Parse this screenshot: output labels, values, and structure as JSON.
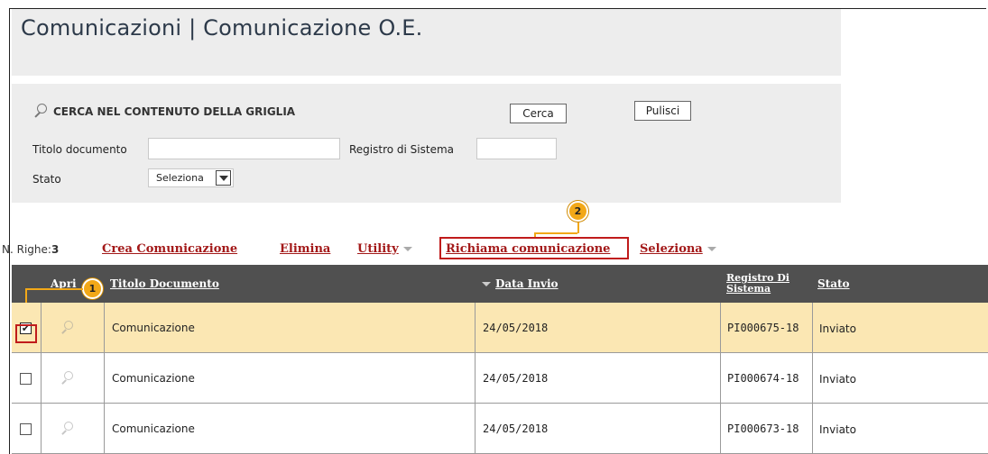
{
  "page": {
    "title": "Comunicazioni | Comunicazione O.E."
  },
  "search": {
    "heading": "CERCA NEL CONTENUTO DELLA GRIGLIA",
    "search_button": "Cerca",
    "clear_button": "Pulisci",
    "fields": {
      "titolo_label": "Titolo documento",
      "titolo_value": "",
      "registro_label": "Registro di Sistema",
      "registro_value": "",
      "stato_label": "Stato",
      "stato_selected": "Seleziona"
    }
  },
  "toolbar": {
    "rows_label": "N. Righe:",
    "rows_count": "3",
    "crea": "Crea Comunicazione",
    "elimina": "Elimina",
    "utility": "Utility",
    "richiama": "Richiama comunicazione",
    "seleziona": "Seleziona"
  },
  "callouts": {
    "one": "1",
    "two": "2"
  },
  "grid": {
    "columns": {
      "apri": "Apri",
      "titolo": "Titolo Documento",
      "data_invio": "Data Invio",
      "registro_line1": "Registro Di",
      "registro_line2": "Sistema",
      "stato": "Stato"
    },
    "rows": [
      {
        "checked": true,
        "titolo": "Comunicazione",
        "data_invio": "24/05/2018",
        "registro": "PI000675-18",
        "stato": "Inviato"
      },
      {
        "checked": false,
        "titolo": "Comunicazione",
        "data_invio": "24/05/2018",
        "registro": "PI000674-18",
        "stato": "Inviato"
      },
      {
        "checked": false,
        "titolo": "Comunicazione",
        "data_invio": "24/05/2018",
        "registro": "PI000673-18",
        "stato": "Inviato"
      }
    ]
  },
  "colors": {
    "accent_link": "#a31919",
    "highlight_row": "#fbe7b3",
    "header_bg": "#505050",
    "callout": "#f2a818",
    "annotation_box": "#c01b1b"
  }
}
